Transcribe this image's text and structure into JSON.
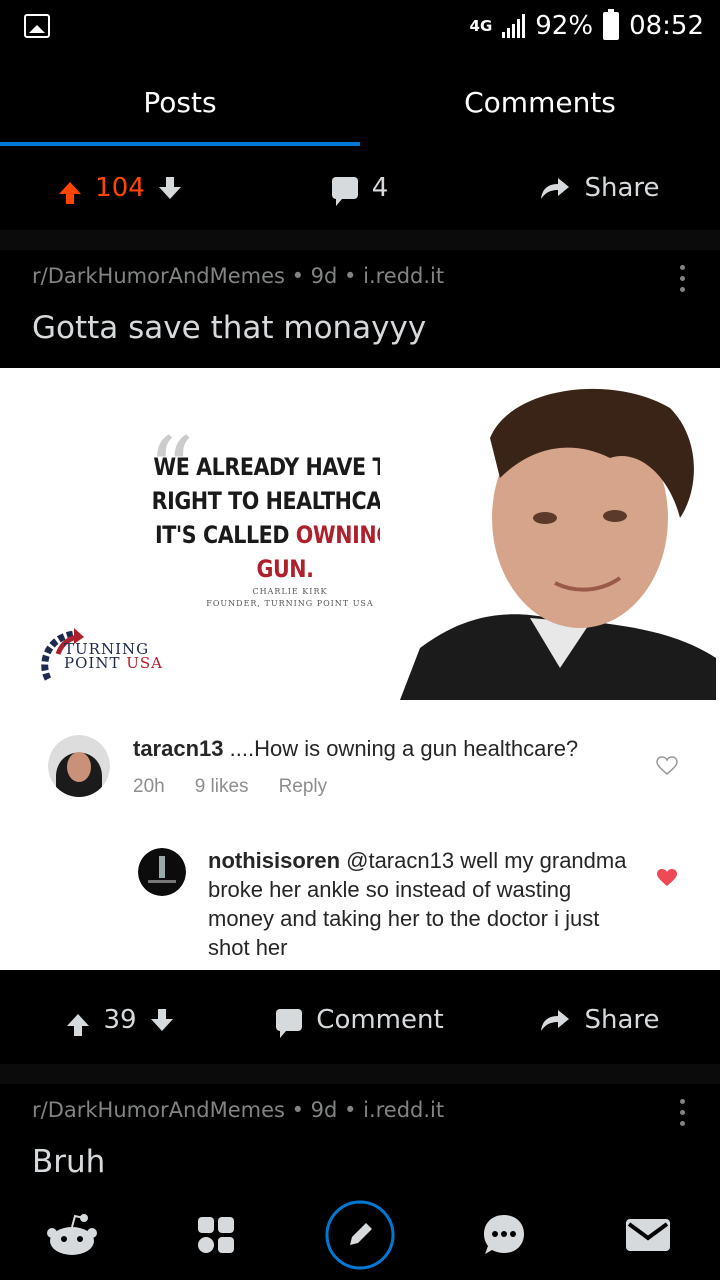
{
  "status_bar": {
    "network": "4G",
    "battery": "92%",
    "time": "08:52",
    "icons": [
      "image-icon",
      "signal-icon",
      "battery-icon"
    ]
  },
  "tabs": [
    {
      "label": "Posts",
      "active": true
    },
    {
      "label": "Comments",
      "active": false
    }
  ],
  "top_actions": {
    "upvotes": "104",
    "comments": "4",
    "share_label": "Share",
    "upvote_color": "#ff4500"
  },
  "post": {
    "meta": "r/DarkHumorAndMemes • 9d • i.redd.it",
    "title": "Gotta save that monayyy",
    "image": {
      "quote_line1": "WE ALREADY HAVE THE",
      "quote_line2": "RIGHT TO HEALTHCARE.",
      "quote_line3_prefix": "IT'S CALLED ",
      "quote_line3_highlight": "OWNING A GUN.",
      "author_name": "CHARLIE KIRK",
      "author_role": "FOUNDER, TURNING POINT USA",
      "logo_line1": "TURNING",
      "logo_line2a": "POINT ",
      "logo_line2b": "USA",
      "comment1": {
        "user": "taracn13",
        "text": " ....How is owning a gun healthcare?",
        "time": "20h",
        "likes": "9 likes",
        "reply": "Reply"
      },
      "comment2": {
        "user": "nothisisoren",
        "text": " @taracn13 well my grandma broke her ankle so instead of wasting money and taking her to the doctor i just shot her"
      }
    }
  },
  "post_actions": {
    "votes": "39",
    "comment_label": "Comment",
    "share_label": "Share"
  },
  "next_post": {
    "meta": "r/DarkHumorAndMemes • 9d • i.redd.it",
    "title": "Bruh"
  },
  "bottom_nav": [
    "home-icon",
    "communities-icon",
    "create-post-icon",
    "chat-icon",
    "inbox-icon"
  ],
  "colors": {
    "accent": "#0079d3",
    "upvote": "#ff4500",
    "text": "#d7dadc",
    "meta": "#818384"
  }
}
